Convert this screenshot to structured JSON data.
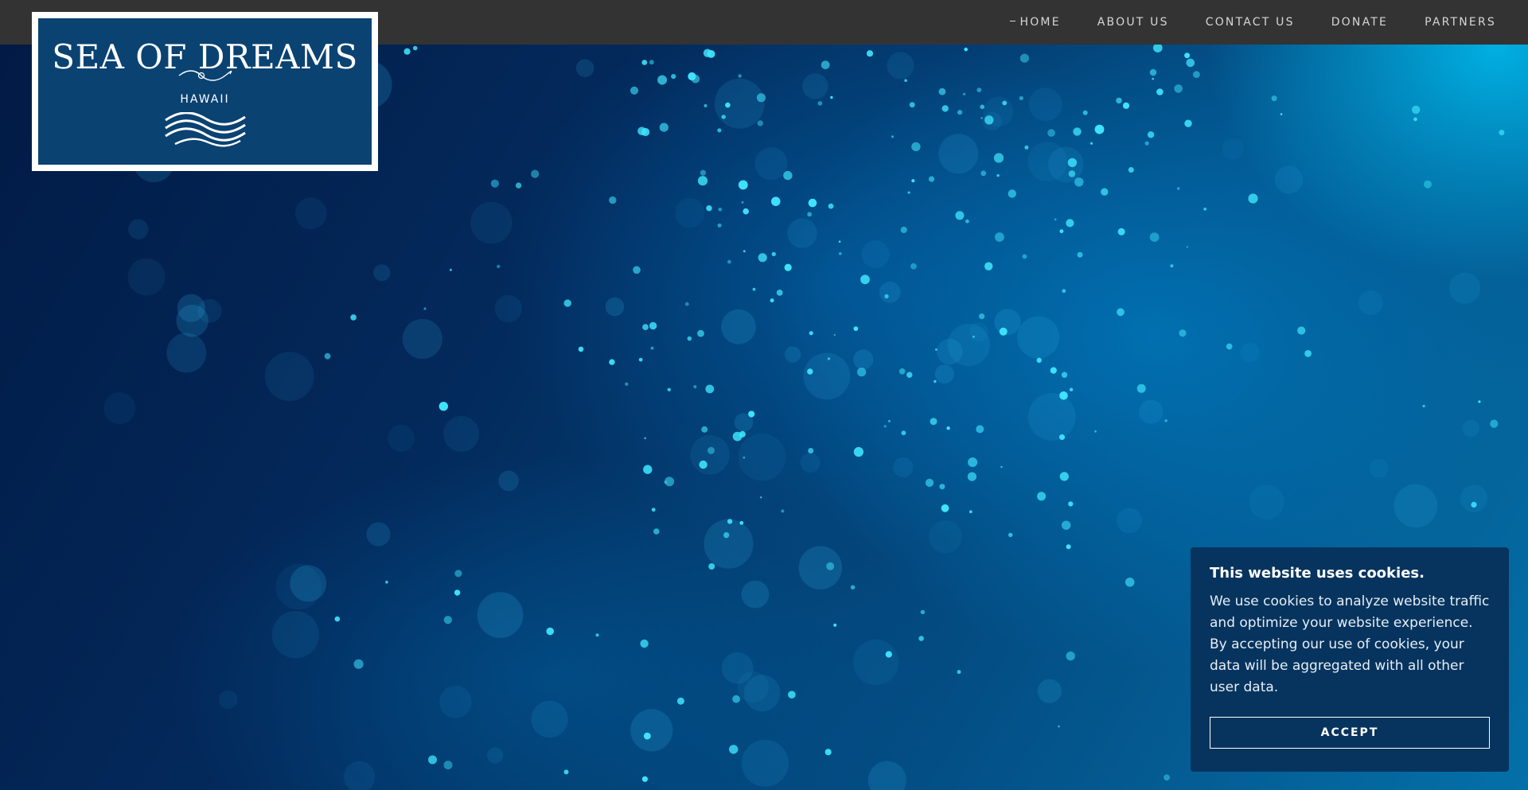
{
  "header": {
    "nav": [
      {
        "id": "home",
        "label": "HOME",
        "active": true
      },
      {
        "id": "about-us",
        "label": "ABOUT US",
        "active": false
      },
      {
        "id": "contact-us",
        "label": "CONTACT US",
        "active": false
      },
      {
        "id": "donate",
        "label": "DONATE",
        "active": false
      },
      {
        "id": "partners",
        "label": "PARTNERS",
        "active": false
      }
    ]
  },
  "logo": {
    "title": "SEA OF DREAMS",
    "subtitle": "HAWAII",
    "icon": "wave-icon"
  },
  "cookie_banner": {
    "title": "This website uses cookies.",
    "body": "We use cookies to analyze website traffic and optimize your website experience. By accepting our use of cookies, your data will be aggregated with all other user data.",
    "accept_label": "ACCEPT"
  },
  "colors": {
    "topbar": "#333333",
    "logo_background": "#0a4272",
    "cookie_background": "#07345e",
    "particle": "#3fe6ff"
  }
}
